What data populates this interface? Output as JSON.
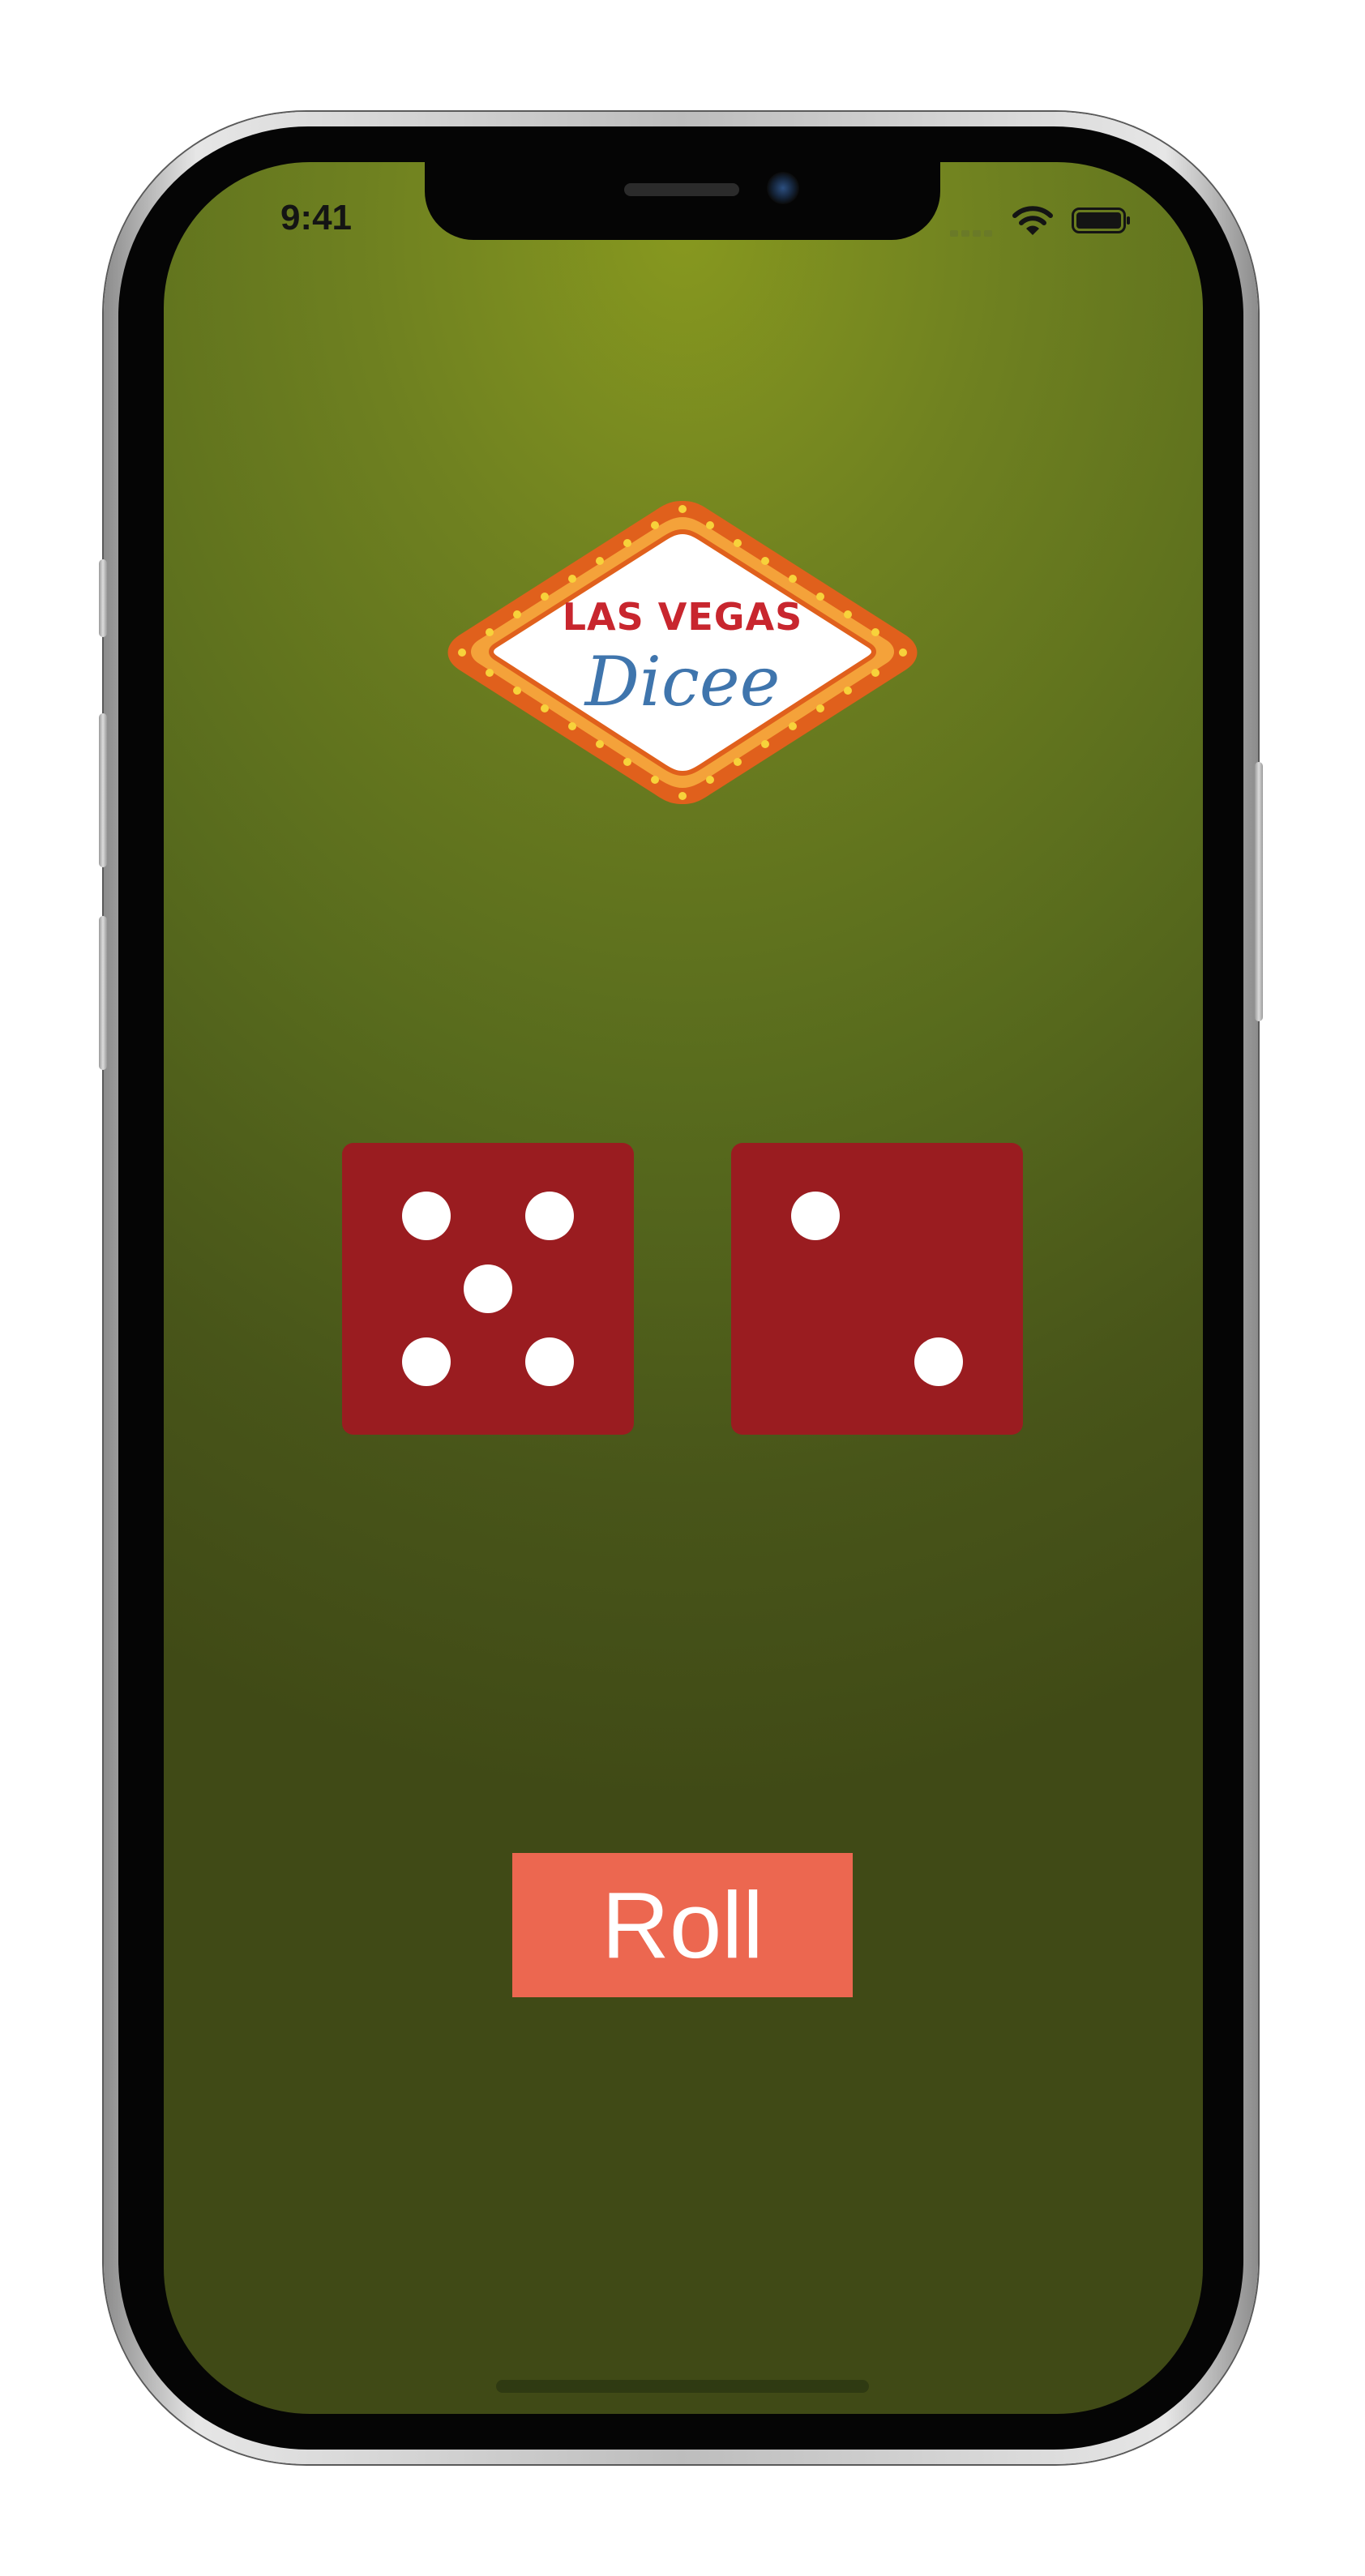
{
  "status_bar": {
    "time": "9:41",
    "signal_icon": "cellular-signal-icon",
    "wifi_icon": "wifi-icon",
    "battery_icon": "battery-icon"
  },
  "logo": {
    "title": "LAS VEGAS",
    "script": "Dicee",
    "colors": {
      "border": "#e0601c",
      "bulbs": "#f7b21b",
      "title": "#c8262e",
      "script": "#3f75ad"
    }
  },
  "dice": [
    {
      "value": 5,
      "color": "#9a1c20"
    },
    {
      "value": 2,
      "color": "#9a1c20"
    }
  ],
  "roll_button": {
    "label": "Roll",
    "color": "#ec6750"
  }
}
